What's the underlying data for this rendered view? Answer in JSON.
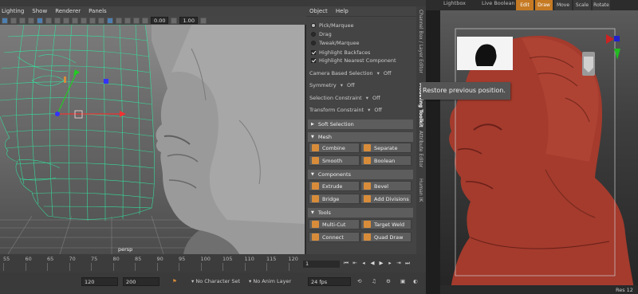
{
  "maya": {
    "menubar": [
      "Lighting",
      "Show",
      "Renderer",
      "Panels"
    ],
    "toolbar": {
      "field_1": "0.00",
      "field_2": "1.00"
    },
    "viewport_label": "persp",
    "side_panel": {
      "menu": [
        "Object",
        "Help"
      ],
      "radios": [
        {
          "label": "Pick/Marquee",
          "selected": true
        },
        {
          "label": "Drag",
          "selected": false
        },
        {
          "label": "Tweak/Marquee",
          "selected": false
        }
      ],
      "checkboxes": [
        {
          "label": "Highlight Backfaces",
          "checked": true
        },
        {
          "label": "Highlight Nearest Component",
          "checked": true
        }
      ],
      "options": [
        {
          "label": "Camera Based Selection",
          "value": "Off"
        },
        {
          "label": "Symmetry",
          "value": "Off"
        },
        {
          "label": "Selection Constraint",
          "value": "Off"
        },
        {
          "label": "Transform Constraint",
          "value": "Off"
        }
      ],
      "soft_selection": "Soft Selection",
      "sections": {
        "mesh": {
          "title": "Mesh",
          "buttons": [
            "Combine",
            "Separate",
            "Smooth",
            "Boolean"
          ]
        },
        "components": {
          "title": "Components",
          "buttons": [
            "Extrude",
            "Bevel",
            "Bridge",
            "Add Divisions"
          ]
        },
        "tools": {
          "title": "Tools",
          "buttons": [
            "Multi-Cut",
            "Target Weld",
            "Connect",
            "Quad Draw"
          ]
        }
      }
    },
    "vertical_tabs": [
      "Channel Box / Layer Editor",
      "Modeling Toolkit",
      "Attribute Editor",
      "Human IK"
    ],
    "timeline": {
      "ticks": [
        "55",
        "60",
        "65",
        "70",
        "75",
        "80",
        "85",
        "90",
        "95",
        "100",
        "105",
        "110",
        "115",
        "120"
      ],
      "current_frame": "1"
    },
    "range": {
      "end_frame": "120",
      "anim_end": "200",
      "character_set": "No Character Set",
      "anim_layer": "No Anim Layer",
      "fps": "24 fps"
    }
  },
  "zbrush": {
    "tabs": [
      "Lightbox",
      "Live Boolean"
    ],
    "tools": [
      {
        "label": "Edit",
        "active": true
      },
      {
        "label": "Draw",
        "active": true
      },
      {
        "label": "Move",
        "active": false
      },
      {
        "label": "Scale",
        "active": false
      },
      {
        "label": "Rotate",
        "active": false
      }
    ],
    "tooltip": "Restore previous position.",
    "res_label": "Res 12"
  },
  "colors": {
    "wireframe": "#33e39e",
    "zbrush_accent": "#c57a23",
    "sculpt_red": "#a43b2d"
  }
}
